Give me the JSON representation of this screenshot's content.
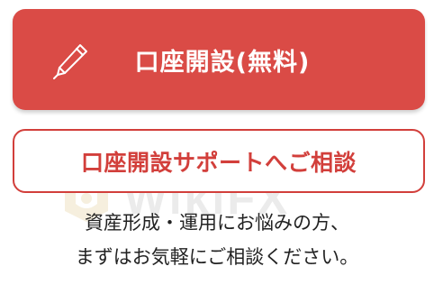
{
  "primary_button": {
    "label": "口座開設(無料)",
    "icon": "pen-icon"
  },
  "secondary_button": {
    "label": "口座開設サポートへご相談"
  },
  "description": {
    "line1": "資産形成・運用にお悩みの方、",
    "line2": "まずはお気軽にご相談ください。"
  },
  "watermark": {
    "text": "WikiFX"
  },
  "colors": {
    "accent": "#da4b46",
    "outline": "#d23f3b",
    "text": "#222222"
  }
}
